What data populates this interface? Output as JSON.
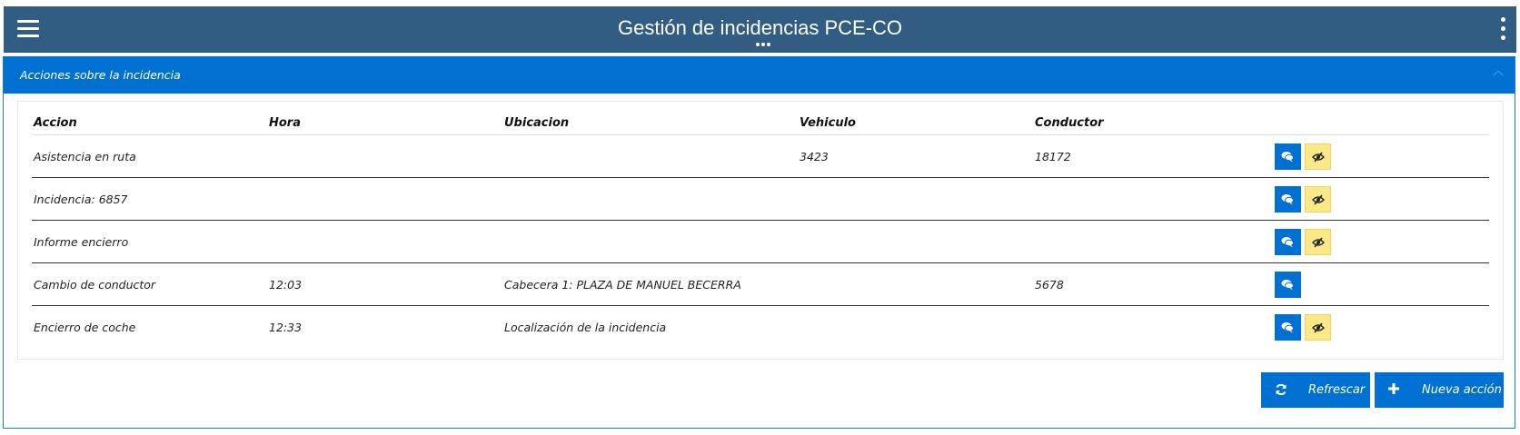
{
  "header": {
    "title": "Gestión de incidencias PCE-CO",
    "menu_icon": "hamburger-icon",
    "overflow_icon": "kebab-icon"
  },
  "panel": {
    "title": "Acciones sobre la incidencia",
    "collapse_icon": "chevron-up-icon"
  },
  "table": {
    "columns": [
      "Accion",
      "Hora",
      "Ubicacion",
      "Vehiculo",
      "Conductor"
    ],
    "rows": [
      {
        "accion": "Asistencia en ruta",
        "hora": "",
        "ubicacion": "",
        "vehiculo": "3423",
        "conductor": "18172",
        "has_eye": true
      },
      {
        "accion": "Incidencia: 6857",
        "hora": "",
        "ubicacion": "",
        "vehiculo": "",
        "conductor": "",
        "has_eye": true
      },
      {
        "accion": "Informe encierro",
        "hora": "",
        "ubicacion": "",
        "vehiculo": "",
        "conductor": "",
        "has_eye": true
      },
      {
        "accion": "Cambio de conductor",
        "hora": "12:03",
        "ubicacion": "Cabecera 1: PLAZA DE MANUEL BECERRA",
        "vehiculo": "",
        "conductor": "5678",
        "has_eye": false
      },
      {
        "accion": "Encierro de coche",
        "hora": "12:33",
        "ubicacion": "Localización de la incidencia",
        "vehiculo": "",
        "conductor": "",
        "has_eye": true
      }
    ]
  },
  "buttons": {
    "refresh_label": "Refrescar",
    "refresh_icon": "refresh-icon",
    "new_label": "Nueva acción",
    "new_icon": "plus-icon"
  },
  "colors": {
    "header_bg": "#325d82",
    "panel_header_bg": "#0070d2",
    "primary_button": "#0070d2",
    "eye_button": "#fbe886"
  }
}
